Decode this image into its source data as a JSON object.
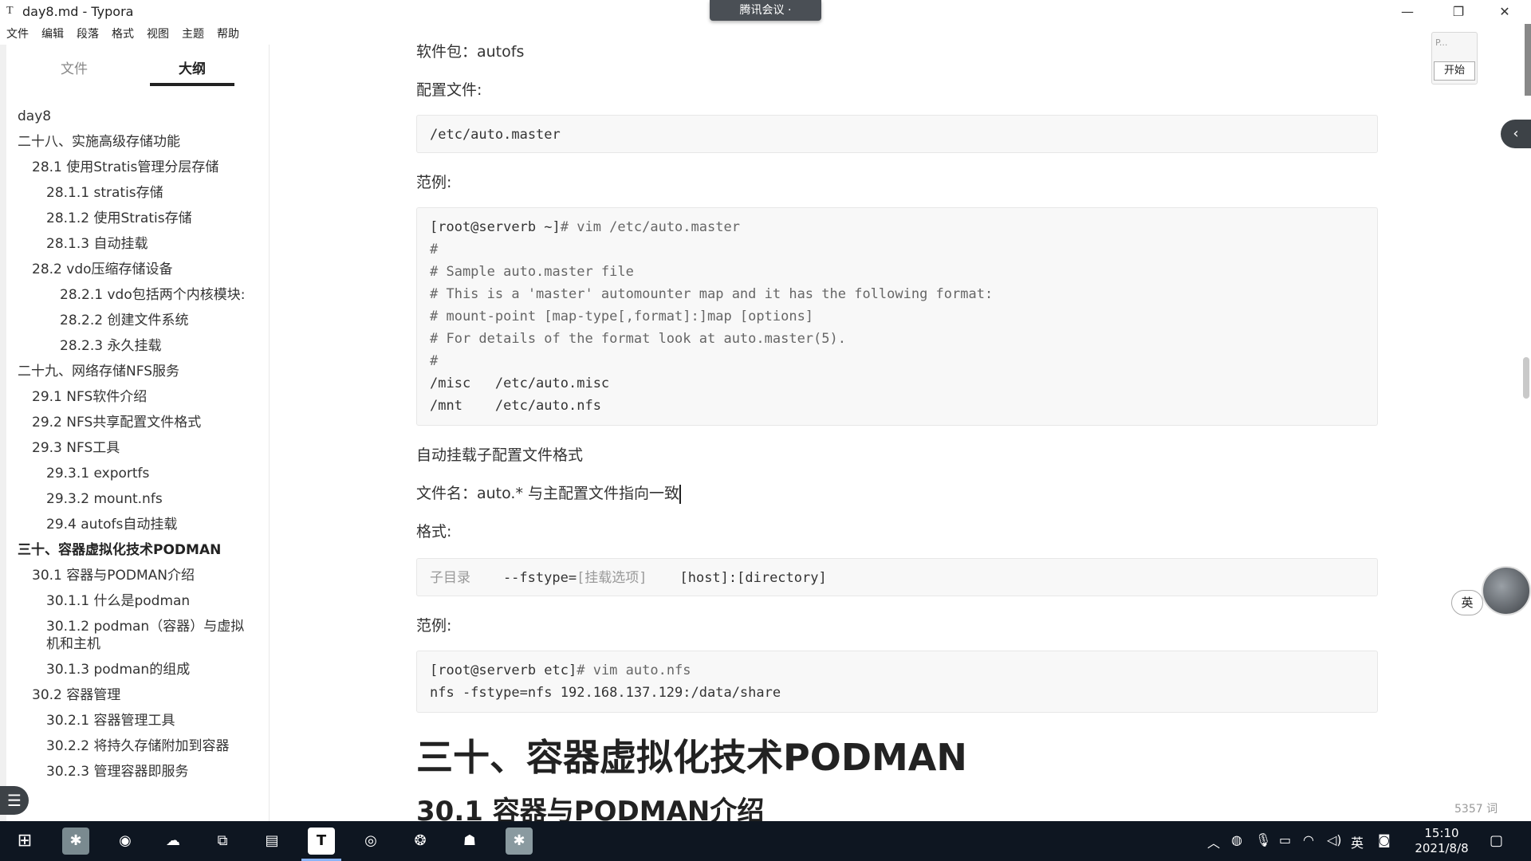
{
  "window": {
    "app_icon": "T",
    "title": "day8.md - Typora",
    "minimize_icon": "minimize-icon",
    "restore_icon": "restore-icon",
    "close_icon": "close-icon"
  },
  "meeting_bar": {
    "label": "腾讯会议 ·"
  },
  "menu": [
    "文件",
    "编辑",
    "段落",
    "格式",
    "视图",
    "主题",
    "帮助"
  ],
  "sidebar": {
    "tabs": {
      "files": "文件",
      "outline": "大纲"
    },
    "outline": [
      {
        "label": "day8",
        "level": 1
      },
      {
        "label": "二十八、实施高级存储功能",
        "level": 1
      },
      {
        "label": "28.1 使用Stratis管理分层存储",
        "level": 2
      },
      {
        "label": "28.1.1 stratis存储",
        "level": 3
      },
      {
        "label": "28.1.2 使用Stratis存储",
        "level": 3
      },
      {
        "label": "28.1.3 自动挂载",
        "level": 3
      },
      {
        "label": "28.2 vdo压缩存储设备",
        "level": 2
      },
      {
        "label": "28.2.1 vdo包括两个内核模块:",
        "level": 4
      },
      {
        "label": "28.2.2 创建文件系统",
        "level": 4
      },
      {
        "label": "28.2.3 永久挂载",
        "level": 4
      },
      {
        "label": "二十九、网络存储NFS服务",
        "level": 1
      },
      {
        "label": "29.1 NFS软件介绍",
        "level": 2
      },
      {
        "label": "29.2 NFS共享配置文件格式",
        "level": 2
      },
      {
        "label": "29.3 NFS工具",
        "level": 2
      },
      {
        "label": "29.3.1 exportfs",
        "level": 3
      },
      {
        "label": "29.3.2 mount.nfs",
        "level": 3
      },
      {
        "label": "29.4 autofs自动挂载",
        "level": 3
      },
      {
        "label": "三十、容器虚拟化技术PODMAN",
        "level": 1,
        "bold": true
      },
      {
        "label": "30.1 容器与PODMAN介绍",
        "level": 2
      },
      {
        "label": "30.1.1 什么是podman",
        "level": 3
      },
      {
        "label": "30.1.2 podman（容器）与虚拟机和主机",
        "level": 3,
        "wrap": true
      },
      {
        "label": "30.1.3 podman的组成",
        "level": 3
      },
      {
        "label": "30.2 容器管理",
        "level": 2
      },
      {
        "label": "30.2.1 容器管理工具",
        "level": 3
      },
      {
        "label": "30.2.2 将持久存储附加到容器",
        "level": 3
      },
      {
        "label": "30.2.3 管理容器即服务",
        "level": 3
      }
    ],
    "footer": {
      "back": "‹",
      "source": "</>"
    }
  },
  "editor": {
    "p1": "软件包：autofs",
    "p2": "配置文件:",
    "code1": "/etc/auto.master",
    "p3": "范例:",
    "code2": [
      {
        "prompt": "[root@serverb ~]",
        "rest": "# vim /etc/auto.master"
      },
      {
        "text": "#"
      },
      {
        "text": "# Sample auto.master file"
      },
      {
        "text": "# This is a 'master' automounter map and it has the following format:"
      },
      {
        "text": "# mount-point [map-type[,format]:]map [options]"
      },
      {
        "text": "# For details of the format look at auto.master(5)."
      },
      {
        "text": "#"
      },
      {
        "text": "/misc   /etc/auto.misc"
      },
      {
        "text": "/mnt    /etc/auto.nfs"
      }
    ],
    "p4": "自动挂载子配置文件格式",
    "p5": "文件名：auto.* 与主配置文件指向一致",
    "p6": "格式:",
    "code3": {
      "a": "子目录",
      "b": "    --fstype=",
      "c": "[挂载选项]",
      "d": "    [host]:[directory]"
    },
    "p7": "范例:",
    "code4": [
      {
        "prompt": "[root@serverb etc]",
        "rest": "# vim auto.nfs"
      },
      {
        "text": "nfs -fstype=nfs 192.168.137.129:/data/share"
      }
    ],
    "h1": "三十、容器虚拟化技术PODMAN",
    "h2": "30.1 容器与PODMAN介绍"
  },
  "widgets": {
    "mini_window_label": "P...",
    "start_button": "开始",
    "ime": "英",
    "word_count": "5357 词"
  },
  "taskbar": {
    "time": "15:10",
    "date": "2021/8/8",
    "ime": "英"
  }
}
